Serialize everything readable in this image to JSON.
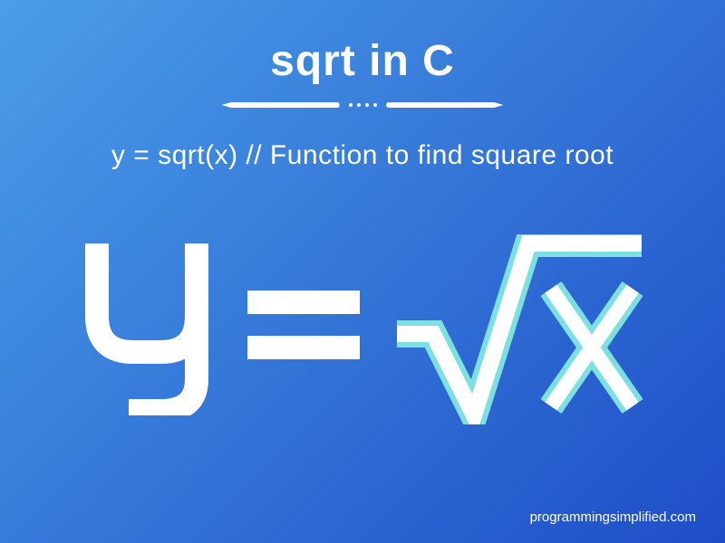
{
  "title": "sqrt in C",
  "code_line": "y = sqrt(x) // Function to find square root",
  "formula": {
    "lhs": "y",
    "rhs_operand": "x"
  },
  "attribution": "programmingsimplified.com",
  "colors": {
    "accent_teal": "#7de0e0",
    "white": "#ffffff"
  }
}
